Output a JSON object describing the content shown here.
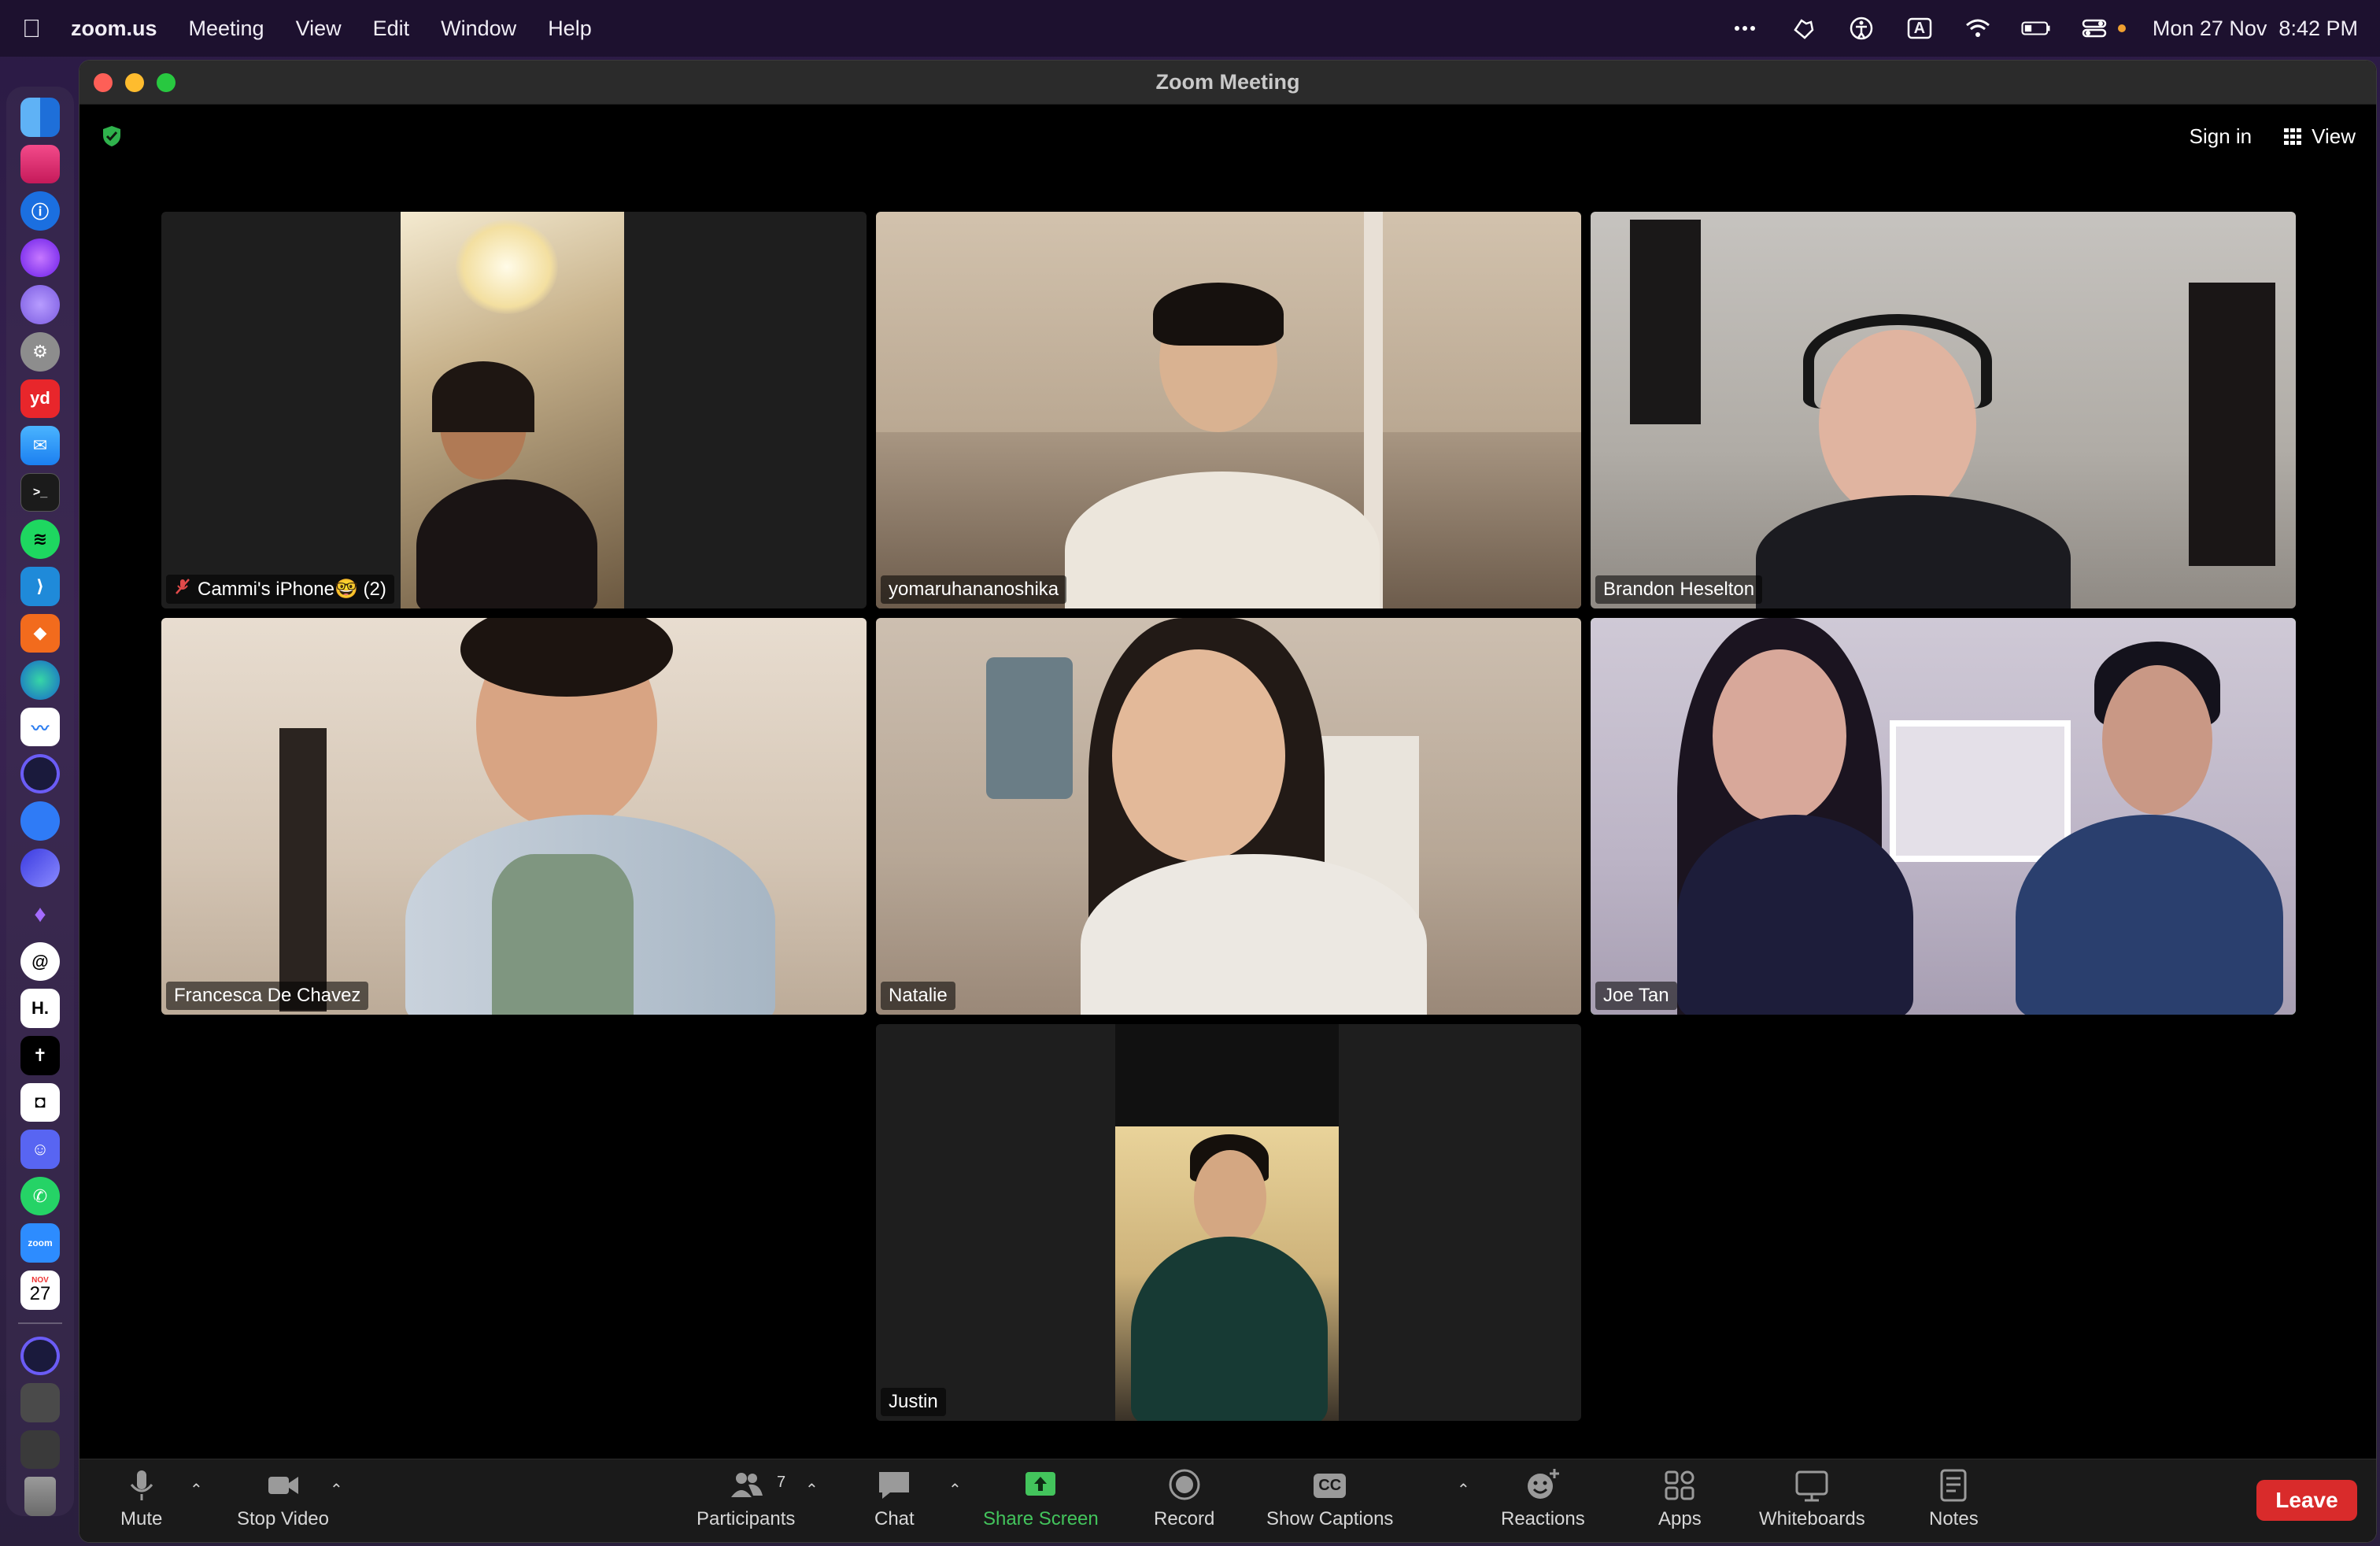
{
  "menubar": {
    "app_name": "zoom.us",
    "items": [
      "Meeting",
      "View",
      "Edit",
      "Window",
      "Help"
    ],
    "clock": "Mon 27 Nov  8:42 PM",
    "keyboard_input": "A"
  },
  "window": {
    "title": "Zoom Meeting",
    "sign_in": "Sign in",
    "view_label": "View"
  },
  "participants": [
    {
      "name": "Cammi's iPhone🤓 (2)",
      "muted": true,
      "active": false
    },
    {
      "name": "yomaruhananoshika",
      "muted": false,
      "active": false
    },
    {
      "name": "Brandon Heselton",
      "muted": false,
      "active": false
    },
    {
      "name": "Francesca De Chavez",
      "muted": false,
      "active": false
    },
    {
      "name": "Natalie",
      "muted": false,
      "active": false
    },
    {
      "name": "Joe Tan",
      "muted": false,
      "active": true
    },
    {
      "name": "Justin",
      "muted": false,
      "active": false
    }
  ],
  "toolbar": {
    "mute": "Mute",
    "stop_video": "Stop Video",
    "participants": "Participants",
    "participants_count": "7",
    "chat": "Chat",
    "share_screen": "Share Screen",
    "record": "Record",
    "show_captions": "Show Captions",
    "captions_badge": "CC",
    "reactions": "Reactions",
    "apps": "Apps",
    "whiteboards": "Whiteboards",
    "notes": "Notes",
    "leave": "Leave"
  },
  "dock": {
    "calendar_month": "NOV",
    "calendar_day": "27",
    "yd_label": "yd",
    "h_label": "H.",
    "zoom_label": "zoom"
  },
  "colors": {
    "active_speaker": "#3fbe3f",
    "leave_button": "#d92b2b",
    "share_screen": "#43c45c"
  }
}
